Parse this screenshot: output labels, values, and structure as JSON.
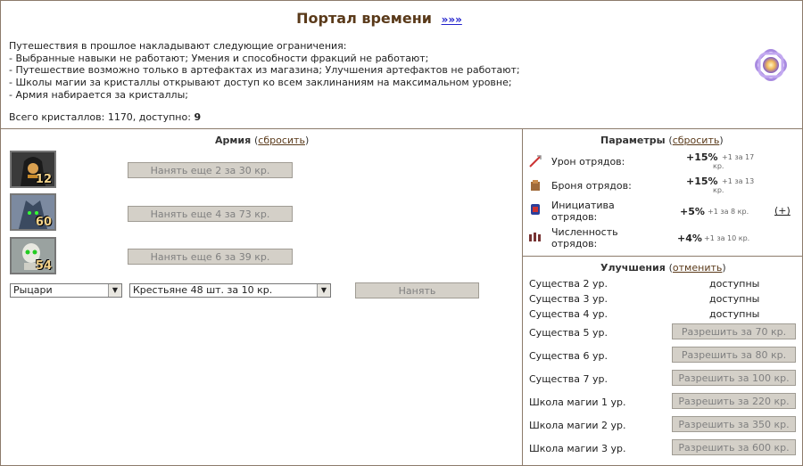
{
  "header": {
    "title": "Портал времени",
    "more_link": "»»»",
    "intro_lines": [
      "Путешествия в прошлое накладывают следующие ограничения:",
      "- Выбранные навыки не работают; Умения и способности фракций не работают;",
      "- Путешествие возможно только в артефактах из магазина; Улучшения артефактов не работают;",
      "- Школы магии за кристаллы открывают доступ ко всем заклинаниям на максимальном уровне;",
      "- Армия набирается за кристаллы;"
    ],
    "crystals_label": "Всего кристаллов: 1170, доступно:",
    "crystals_available": "9"
  },
  "army": {
    "title": "Армия",
    "reset_link": "сбросить",
    "units": [
      {
        "icon": "hooded-mage-portrait",
        "count": "12",
        "hire_label": "Нанять еще 2 за 30 кр."
      },
      {
        "icon": "elf-warrior-portrait",
        "count": "60",
        "hire_label": "Нанять еще 4 за 73 кр."
      },
      {
        "icon": "skeleton-portrait",
        "count": "54",
        "hire_label": "Нанять еще 6 за 39 кр."
      }
    ],
    "faction_select": "Рыцари",
    "unit_select": "Крестьяне 48 шт. за 10 кр.",
    "hire_button": "Нанять"
  },
  "params": {
    "title": "Параметры",
    "reset_link": "сбросить",
    "rows": [
      {
        "icon": "sword-icon",
        "label1": "Урон отрядов:",
        "label2": "",
        "value": "+15%",
        "cost1": "+1 за 17",
        "cost2": "кр."
      },
      {
        "icon": "armor-icon",
        "label1": "Броня отрядов:",
        "label2": "",
        "value": "+15%",
        "cost1": "+1 за 13",
        "cost2": "кр."
      },
      {
        "icon": "initiative-icon",
        "label1": "Инициатива",
        "label2": "отрядов:",
        "value": "+5%",
        "cost1": "+1 за 8 кр.",
        "cost2": "",
        "plus": "(+)"
      },
      {
        "icon": "troops-icon",
        "label1": "Численность",
        "label2": "отрядов:",
        "value": "+4%",
        "cost1": "+1 за 10 кр.",
        "cost2": ""
      }
    ]
  },
  "upgrades": {
    "title": "Улучшения",
    "cancel_link": "отменить",
    "rows": [
      {
        "label": "Существа 2 ур.",
        "status": "доступны"
      },
      {
        "label": "Существа 3 ур.",
        "status": "доступны"
      },
      {
        "label": "Существа 4 ур.",
        "status": "доступны"
      },
      {
        "label": "Существа 5 ур.",
        "button": "Разрешить за 70 кр."
      },
      {
        "label": "Существа 6 ур.",
        "button": "Разрешить за 80 кр."
      },
      {
        "label": "Существа 7 ур.",
        "button": "Разрешить за 100 кр."
      },
      {
        "label": "Школа магии 1 ур.",
        "button": "Разрешить за 220 кр."
      },
      {
        "label": "Школа магии 2 ур.",
        "button": "Разрешить за 350 кр."
      },
      {
        "label": "Школа магии 3 ур.",
        "button": "Разрешить за 600 кр."
      }
    ]
  }
}
